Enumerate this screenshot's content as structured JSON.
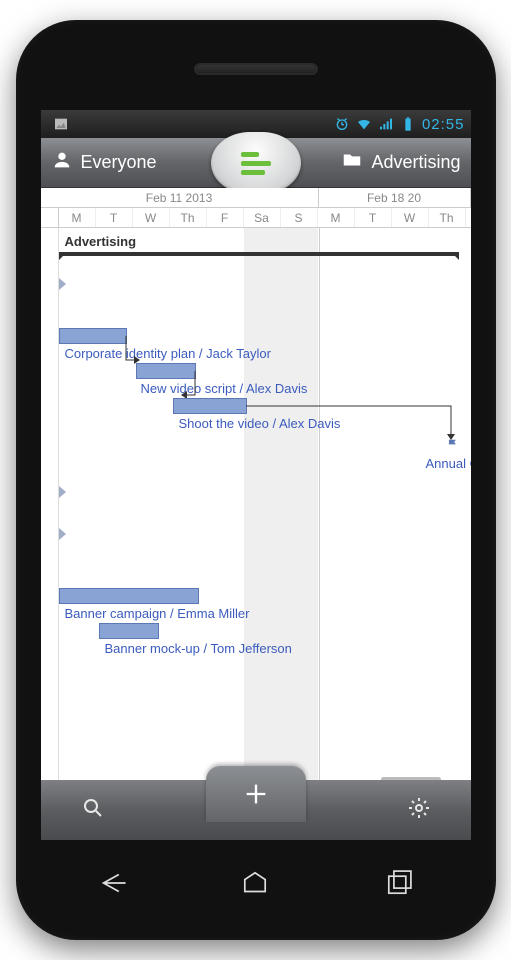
{
  "statusbar": {
    "time": "02:55"
  },
  "toolbar": {
    "left_label": "Everyone",
    "right_label": "Advertising"
  },
  "gantt": {
    "weeks": [
      "Feb 11 2013",
      "Feb 18 20"
    ],
    "days": [
      "M",
      "T",
      "W",
      "Th",
      "F",
      "Sa",
      "S",
      "M",
      "T",
      "W",
      "Th"
    ],
    "group_label": "Advertising",
    "tasks": [
      {
        "label": "Corporate identity plan / Jack Taylor"
      },
      {
        "label": "New video script / Alex Davis"
      },
      {
        "label": "Shoot the video / Alex Davis"
      },
      {
        "label": "Annual Cor"
      },
      {
        "label": "Banner campaign / Emma Miller"
      },
      {
        "label": "Banner mock-up / Tom Jefferson"
      }
    ]
  }
}
